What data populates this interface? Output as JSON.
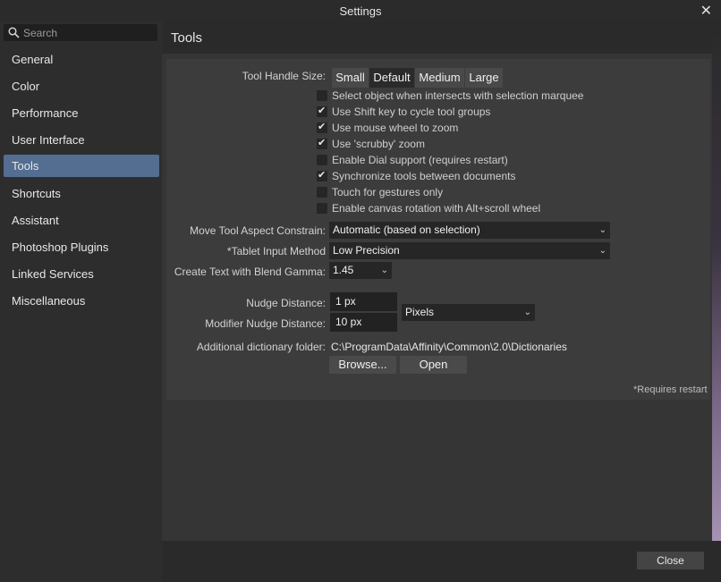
{
  "window": {
    "title": "Settings",
    "close_glyph": "✕"
  },
  "search": {
    "placeholder": "Search"
  },
  "sidebar": {
    "items": [
      {
        "label": "General"
      },
      {
        "label": "Color"
      },
      {
        "label": "Performance"
      },
      {
        "label": "User Interface"
      },
      {
        "label": "Tools",
        "active": true
      },
      {
        "label": "Shortcuts"
      },
      {
        "label": "Assistant"
      },
      {
        "label": "Photoshop Plugins"
      },
      {
        "label": "Linked Services"
      },
      {
        "label": "Miscellaneous"
      }
    ]
  },
  "page": {
    "title": "Tools"
  },
  "tool_handle": {
    "label": "Tool Handle Size:",
    "options": [
      "Small",
      "Default",
      "Medium",
      "Large"
    ],
    "selected": "Default"
  },
  "checkboxes": [
    {
      "label": "Select object when intersects with selection marquee",
      "checked": false
    },
    {
      "label": "Use Shift key to cycle tool groups",
      "checked": true
    },
    {
      "label": "Use mouse wheel to zoom",
      "checked": true
    },
    {
      "label": "Use 'scrubby' zoom",
      "checked": true
    },
    {
      "label": "Enable Dial support (requires restart)",
      "checked": false
    },
    {
      "label": "Synchronize tools between documents",
      "checked": true
    },
    {
      "label": "Touch for gestures only",
      "checked": false
    },
    {
      "label": "Enable canvas rotation with Alt+scroll wheel",
      "checked": false
    }
  ],
  "move_tool": {
    "label": "Move Tool Aspect Constrain:",
    "value": "Automatic (based on selection)"
  },
  "tablet": {
    "label": "*Tablet Input Method",
    "value": "Low Precision"
  },
  "blend_gamma": {
    "label": "Create Text with Blend Gamma:",
    "value": "1.45"
  },
  "nudge": {
    "label": "Nudge Distance:",
    "value": "1 px"
  },
  "modifier_nudge": {
    "label": "Modifier Nudge Distance:",
    "value": "10 px"
  },
  "units": {
    "value": "Pixels"
  },
  "dictionary": {
    "label": "Additional dictionary folder:",
    "path": "C:\\ProgramData\\Affinity\\Common\\2.0\\Dictionaries",
    "browse_label": "Browse...",
    "open_label": "Open"
  },
  "footnote": "*Requires restart",
  "footer": {
    "close_label": "Close"
  },
  "icons": {
    "chevron": "⌄",
    "check": "✔"
  },
  "colors": {
    "accent": "#546e91"
  }
}
